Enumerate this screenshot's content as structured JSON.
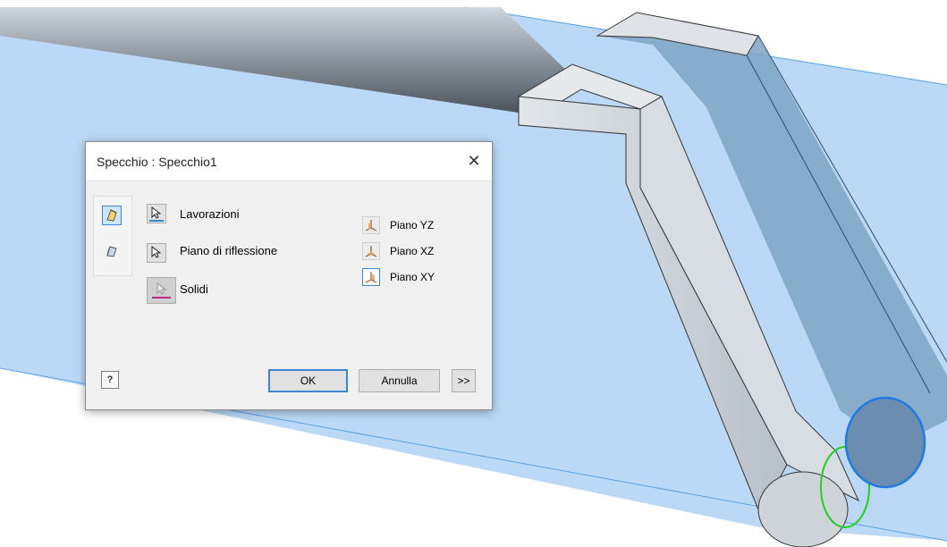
{
  "dialog": {
    "title": "Specchio : Specchio1",
    "close_symbol": "✕",
    "selections": [
      {
        "label": "Lavorazioni",
        "icon": "select-arrow-icon",
        "underline_color": "#3d86cf"
      },
      {
        "label": "Piano di riflessione",
        "icon": "select-arrow-icon"
      },
      {
        "label": "Solidi",
        "icon": "select-arrow-disabled-icon",
        "underline_color": "#c0268a"
      }
    ],
    "planes": [
      {
        "label": "Piano YZ",
        "icon": "plane-yz-icon"
      },
      {
        "label": "Piano XZ",
        "icon": "plane-xz-icon"
      },
      {
        "label": "Piano XY",
        "icon": "plane-xy-icon",
        "active": true
      }
    ],
    "modes": [
      {
        "icon": "mirror-features-icon",
        "active": true
      },
      {
        "icon": "mirror-solid-icon",
        "active": false
      }
    ],
    "buttons": {
      "help": "?",
      "ok": "OK",
      "cancel": "Annulla",
      "more": ">>"
    }
  },
  "colors": {
    "plane_fill": "#b7d7f7",
    "accent": "#3d86cf",
    "part_face": "#c9d2dc",
    "highlight_green": "#22cc22"
  }
}
